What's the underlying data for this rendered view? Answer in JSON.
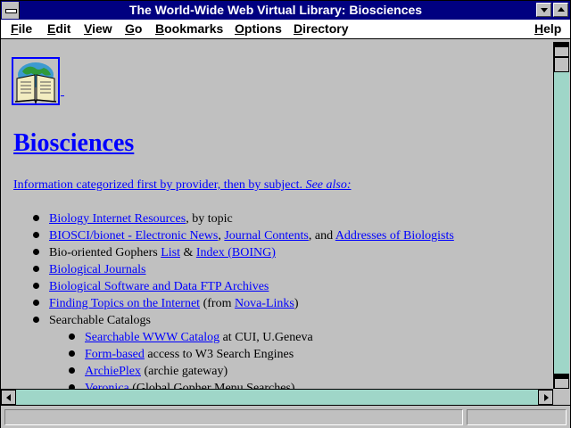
{
  "window": {
    "title": "The World-Wide Web Virtual Library: Biosciences"
  },
  "menu": [
    {
      "key": "F",
      "rest": "ile"
    },
    {
      "key": "E",
      "rest": "dit"
    },
    {
      "key": "V",
      "rest": "iew"
    },
    {
      "key": "G",
      "rest": "o"
    },
    {
      "key": "B",
      "rest": "ookmarks"
    },
    {
      "key": "O",
      "rest": "ptions"
    },
    {
      "key": "D",
      "rest": "irectory"
    },
    {
      "key": "H",
      "rest": "elp"
    }
  ],
  "page": {
    "heading": "Biosciences",
    "intro": "Information categorized first by provider, then by subject.",
    "intro_see_also": "See also:",
    "items": {
      "i1": {
        "link": "Biology Internet Resources",
        "text": ", by topic"
      },
      "i2": {
        "link1": "BIOSCI/bionet - Electronic News",
        "sep1": ", ",
        "link2": "Journal Contents",
        "sep2": ", and ",
        "link3": "Addresses of Biologists"
      },
      "i3": {
        "text": "Bio-oriented Gophers ",
        "link1": "List",
        "sep": " & ",
        "link2": "Index (BOING)"
      },
      "i4": {
        "link": "Biological Journals"
      },
      "i5": {
        "link": "Biological Software and Data FTP Archives"
      },
      "i6": {
        "link": "Finding Topics on the Internet",
        "text": " (from ",
        "link2": "Nova-Links",
        "text2": ")"
      },
      "i7": {
        "text": "Searchable Catalogs"
      },
      "s1": {
        "link": "Searchable WWW Catalog",
        "text": " at CUI, U.Geneva"
      },
      "s2": {
        "link": "Form-based",
        "text": " access to W3 Search Engines"
      },
      "s3": {
        "link": "ArchiePlex",
        "text": " (archie gateway)"
      },
      "s4": {
        "link": "Veronica",
        "text": " (Global Gopher Menu Searches)"
      }
    }
  }
}
